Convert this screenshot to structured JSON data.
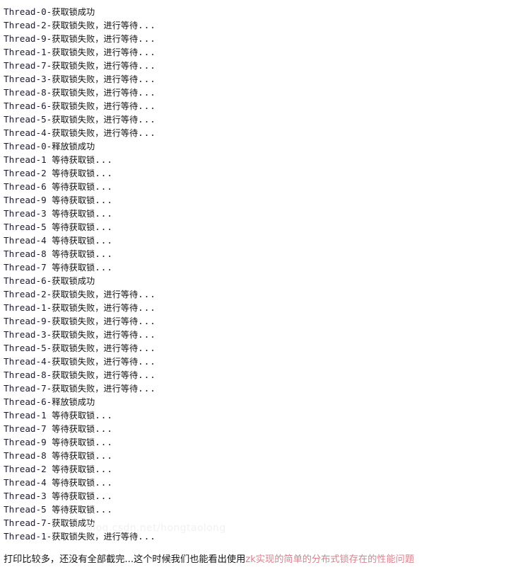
{
  "console": {
    "lines": [
      {
        "thread": "Thread-0",
        "sep": "-",
        "msg": "获取锁成功",
        "dots": ""
      },
      {
        "thread": "Thread-2",
        "sep": "-",
        "msg": "获取锁失败，进行等待",
        "dots": "..."
      },
      {
        "thread": "Thread-9",
        "sep": "-",
        "msg": "获取锁失败，进行等待",
        "dots": "..."
      },
      {
        "thread": "Thread-1",
        "sep": "-",
        "msg": "获取锁失败，进行等待",
        "dots": "..."
      },
      {
        "thread": "Thread-7",
        "sep": "-",
        "msg": "获取锁失败，进行等待",
        "dots": "..."
      },
      {
        "thread": "Thread-3",
        "sep": "-",
        "msg": "获取锁失败，进行等待",
        "dots": "..."
      },
      {
        "thread": "Thread-8",
        "sep": "-",
        "msg": "获取锁失败，进行等待",
        "dots": "..."
      },
      {
        "thread": "Thread-6",
        "sep": "-",
        "msg": "获取锁失败，进行等待",
        "dots": "..."
      },
      {
        "thread": "Thread-5",
        "sep": "-",
        "msg": "获取锁失败，进行等待",
        "dots": "..."
      },
      {
        "thread": "Thread-4",
        "sep": "-",
        "msg": "获取锁失败，进行等待",
        "dots": "..."
      },
      {
        "thread": "Thread-0",
        "sep": "-",
        "msg": "释放锁成功",
        "dots": ""
      },
      {
        "thread": "Thread-1",
        "sep": " ",
        "msg": "等待获取锁",
        "dots": "..."
      },
      {
        "thread": "Thread-2",
        "sep": " ",
        "msg": "等待获取锁",
        "dots": "..."
      },
      {
        "thread": "Thread-6",
        "sep": " ",
        "msg": "等待获取锁",
        "dots": "..."
      },
      {
        "thread": "Thread-9",
        "sep": " ",
        "msg": "等待获取锁",
        "dots": "..."
      },
      {
        "thread": "Thread-3",
        "sep": " ",
        "msg": "等待获取锁",
        "dots": "..."
      },
      {
        "thread": "Thread-5",
        "sep": " ",
        "msg": "等待获取锁",
        "dots": "..."
      },
      {
        "thread": "Thread-4",
        "sep": " ",
        "msg": "等待获取锁",
        "dots": "..."
      },
      {
        "thread": "Thread-8",
        "sep": " ",
        "msg": "等待获取锁",
        "dots": "..."
      },
      {
        "thread": "Thread-7",
        "sep": " ",
        "msg": "等待获取锁",
        "dots": "..."
      },
      {
        "thread": "Thread-6",
        "sep": "-",
        "msg": "获取锁成功",
        "dots": ""
      },
      {
        "thread": "Thread-2",
        "sep": "-",
        "msg": "获取锁失败，进行等待",
        "dots": "..."
      },
      {
        "thread": "Thread-1",
        "sep": "-",
        "msg": "获取锁失败，进行等待",
        "dots": "..."
      },
      {
        "thread": "Thread-9",
        "sep": "-",
        "msg": "获取锁失败，进行等待",
        "dots": "..."
      },
      {
        "thread": "Thread-3",
        "sep": "-",
        "msg": "获取锁失败，进行等待",
        "dots": "..."
      },
      {
        "thread": "Thread-5",
        "sep": "-",
        "msg": "获取锁失败，进行等待",
        "dots": "..."
      },
      {
        "thread": "Thread-4",
        "sep": "-",
        "msg": "获取锁失败，进行等待",
        "dots": "..."
      },
      {
        "thread": "Thread-8",
        "sep": "-",
        "msg": "获取锁失败，进行等待",
        "dots": "..."
      },
      {
        "thread": "Thread-7",
        "sep": "-",
        "msg": "获取锁失败，进行等待",
        "dots": "..."
      },
      {
        "thread": "Thread-6",
        "sep": "-",
        "msg": "释放锁成功",
        "dots": ""
      },
      {
        "thread": "Thread-1",
        "sep": " ",
        "msg": "等待获取锁",
        "dots": "..."
      },
      {
        "thread": "Thread-7",
        "sep": " ",
        "msg": "等待获取锁",
        "dots": "..."
      },
      {
        "thread": "Thread-9",
        "sep": " ",
        "msg": "等待获取锁",
        "dots": "..."
      },
      {
        "thread": "Thread-8",
        "sep": " ",
        "msg": "等待获取锁",
        "dots": "..."
      },
      {
        "thread": "Thread-2",
        "sep": " ",
        "msg": "等待获取锁",
        "dots": "..."
      },
      {
        "thread": "Thread-4",
        "sep": " ",
        "msg": "等待获取锁",
        "dots": "..."
      },
      {
        "thread": "Thread-3",
        "sep": " ",
        "msg": "等待获取锁",
        "dots": "..."
      },
      {
        "thread": "Thread-5",
        "sep": " ",
        "msg": "等待获取锁",
        "dots": "..."
      },
      {
        "thread": "Thread-7",
        "sep": "-",
        "msg": "获取锁成功",
        "dots": ""
      },
      {
        "thread": "Thread-1",
        "sep": "-",
        "msg": "获取锁失败，进行等待",
        "dots": "..."
      }
    ]
  },
  "watermark": {
    "text": "blog.csdn.net/hongtaolong"
  },
  "caption": {
    "plain": "打印比较多，还没有全部截完...这个时候我们也能看出使用",
    "highlight": "zk实现的简单的分布式锁存在的性能问题",
    "highlight_color": "#d9808c"
  }
}
